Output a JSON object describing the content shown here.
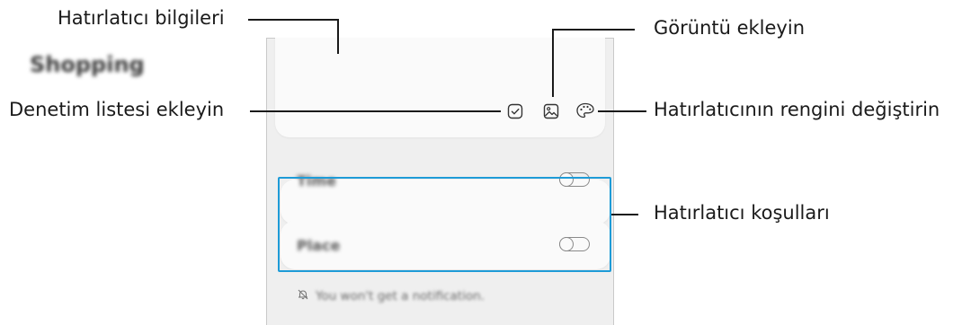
{
  "reminder": {
    "title": "Shopping",
    "conditions": [
      {
        "label": "Time",
        "enabled": false
      },
      {
        "label": "Place",
        "enabled": false
      }
    ],
    "footer_text": "You won't get a notification."
  },
  "callouts": {
    "details": "Hatırlatıcı bilgileri",
    "checklist": "Denetim listesi ekleyin",
    "image": "Görüntü ekleyin",
    "color": "Hatırlatıcının rengini değiştirin",
    "conditions": "Hatırlatıcı koşulları"
  },
  "colors": {
    "highlight": "#1e9bd7",
    "card": "#fafafa",
    "background": "#efefef"
  },
  "icons": [
    "checklist-icon",
    "image-icon",
    "palette-icon",
    "bell-off-icon"
  ]
}
